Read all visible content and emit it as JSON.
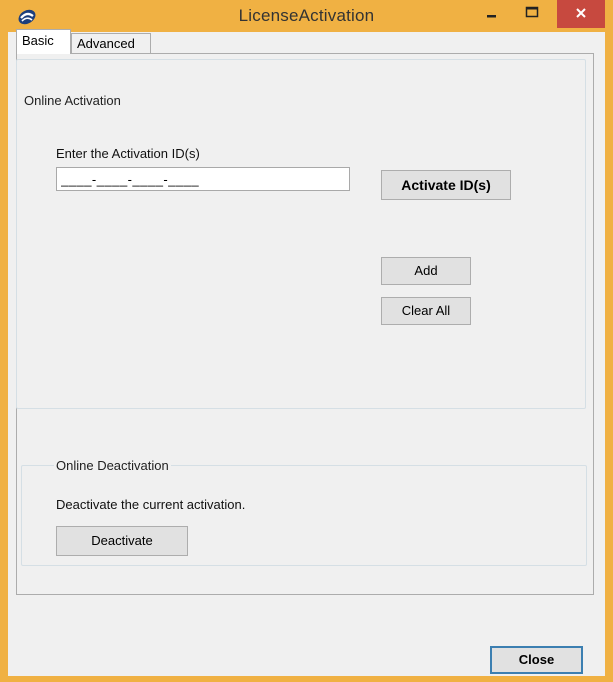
{
  "window": {
    "title": "LicenseActivation"
  },
  "tabs": [
    {
      "label": "Basic",
      "selected": true
    },
    {
      "label": "Advanced",
      "selected": false
    }
  ],
  "online_activation": {
    "group_title": "Online Activation",
    "field_label": "Enter the Activation ID(s)",
    "field_value": "____-____-____-____",
    "activate_label": "Activate ID(s)",
    "add_label": "Add",
    "clear_label": "Clear All"
  },
  "online_deactivation": {
    "group_title": "Online Deactivation",
    "description": "Deactivate the current activation.",
    "deactivate_label": "Deactivate"
  },
  "footer": {
    "close_label": "Close"
  },
  "colors": {
    "title_bar": "#f0b143",
    "close_button": "#c7493f",
    "dialog_bg": "#f0f0f0"
  },
  "icons": [
    "app-logo-icon",
    "minimize-icon",
    "maximize-icon",
    "close-icon"
  ]
}
